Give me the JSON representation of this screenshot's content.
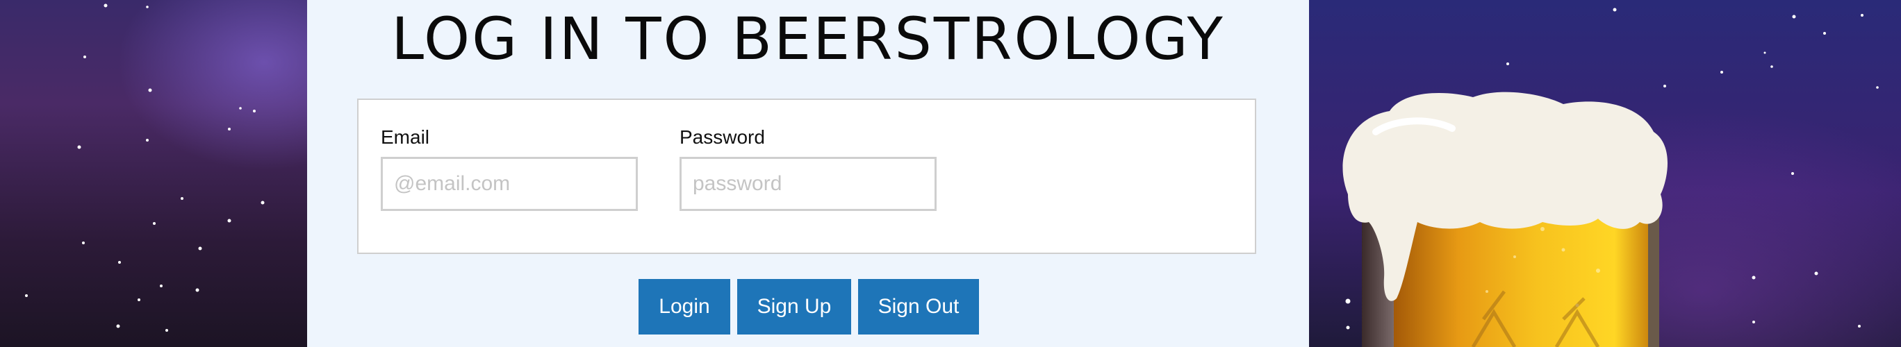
{
  "page": {
    "title": "LOG IN TO BEERSTROLOGY"
  },
  "form": {
    "email": {
      "label": "Email",
      "placeholder": "@email.com",
      "value": ""
    },
    "password": {
      "label": "Password",
      "placeholder": "password",
      "value": ""
    }
  },
  "buttons": {
    "login": "Login",
    "signup": "Sign Up",
    "signout": "Sign Out"
  },
  "colors": {
    "panel_bg": "#eef5fd",
    "button_bg": "#1e75b8",
    "sky": "#2a2a78"
  },
  "decor": {
    "background": "starry-night-sky",
    "right_image": "beer-mug-image"
  }
}
